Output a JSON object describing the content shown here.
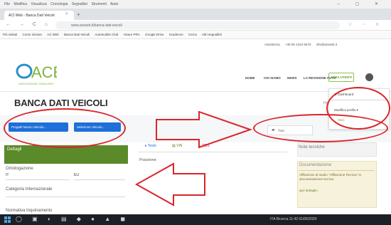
{
  "browser": {
    "menu": [
      "File",
      "Modifica",
      "Visualizza",
      "Cronologia",
      "Segnalibri",
      "Strumenti",
      "Aiuto"
    ],
    "tab_title": "ACI Web - Banca Dati Veicoli",
    "tab_close": "×",
    "new_tab": "+",
    "nav": "← → C ⌂",
    "url": "www.aciweb.it/banca-dati-veicoli",
    "bookmarks": [
      "Più visitati",
      "Come iniziare",
      "Aci Web",
      "Banca Dati Veicoli",
      "Automobile Club",
      "Visure PRA",
      "Google Drive",
      "Scadenze",
      "Cerca",
      "Altri segnalibri"
    ]
  },
  "header": {
    "top_info": [
      "Assistenza",
      "+39 06 1234 5678",
      "info@aciweb.it"
    ],
    "logo_text": "ACE",
    "logo_sub": "ASSOCIAZIONE CONSULENTI",
    "nav": [
      "HOME",
      "CHI SIAMO",
      "NEWS",
      "LA REVISIONE AUTO"
    ],
    "area_riservata": "AREA UTENTI"
  },
  "page": {
    "title": "BANCA DATI VEICOLI",
    "btn_progetti": "Progetti Nuovo Veicolo...",
    "btn_selezione": "Selezione Veicolo...",
    "dettagli": "Dettagli",
    "omologazione_label": "Omologazione",
    "omologazione_left": "IT",
    "omologazione_right": "EU",
    "categoria_label": "Categoria Internazionale",
    "normativa_label": "Normativa Inquinamento",
    "tab_testo": "Testo",
    "tab_vin": "VIN",
    "tab_dbs": "DBS",
    "posizione": "Posizione",
    "nota_tecnica": "Note tecniche",
    "documentazione": "Documentazione",
    "doc_text": "Affiliazione di studio \"Affiliazione Tecnica\" in documentazione tecnica",
    "doc_link": "apri dettaglio",
    "home_link": "Home"
  },
  "dropdown": {
    "items": [
      "Dashboard",
      "Modifica profilo",
      "Esci"
    ],
    "popup_item": "TUA"
  },
  "taskbar": {
    "tray_text": "ITA  Ricerca  11:42  01/06/2020"
  },
  "colors": {
    "accent_green": "#5a8a2a",
    "button_blue": "#1e6fd9",
    "annotation_red": "#d9262c"
  }
}
